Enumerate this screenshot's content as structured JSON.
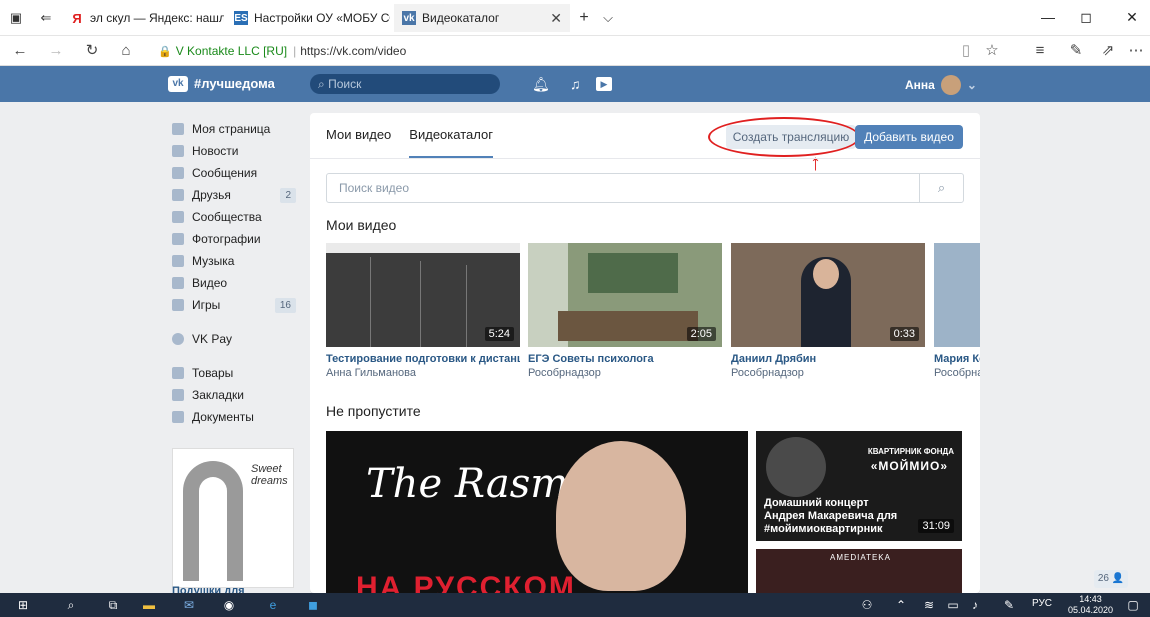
{
  "browser": {
    "tabs": [
      {
        "label": "эл скул — Яндекс: нашлось",
        "favicon": "Я",
        "color": "#e02020"
      },
      {
        "label": "Настройки ОУ «МОБУ СОШ",
        "favicon": "ES",
        "color": "#2a6fb5"
      },
      {
        "label": "Видеокаталог",
        "favicon": "vk",
        "color": "#4a76a8"
      }
    ],
    "new_tab": "+",
    "dropdown": "⌵",
    "close_tab": "✕",
    "url_site": "V Kontakte LLC [RU]",
    "url": "https://vk.com/video",
    "win_min": "—",
    "win_max": "◻",
    "win_close": "✕"
  },
  "vk": {
    "logo": "vk",
    "hashtag": "#лучшедома",
    "search_placeholder": "Поиск",
    "user_name": "Анна",
    "menu": [
      {
        "label": "Моя страница"
      },
      {
        "label": "Новости"
      },
      {
        "label": "Сообщения"
      },
      {
        "label": "Друзья",
        "count": "2"
      },
      {
        "label": "Сообщества"
      },
      {
        "label": "Фотографии"
      },
      {
        "label": "Музыка"
      },
      {
        "label": "Видео"
      },
      {
        "label": "Игры",
        "count": "16"
      },
      {
        "label": "VK Pay"
      },
      {
        "label": "Товары"
      },
      {
        "label": "Закладки"
      },
      {
        "label": "Документы"
      }
    ],
    "ad_logo": "Sweet dreams",
    "ad_title": "Подушки для"
  },
  "videos": {
    "tab_my": "Мои видео",
    "tab_catalog": "Видеокаталог",
    "btn_stream": "Создать трансляцию",
    "btn_add": "Добавить видео",
    "search_placeholder": "Поиск видео",
    "section_my": "Мои видео",
    "items": [
      {
        "title": "Тестирование подготовки к дистанц...",
        "author": "Анна Гильманова",
        "duration": "5:24"
      },
      {
        "title": "ЕГЭ Советы психолога",
        "author": "Рособрнадзор",
        "duration": "2:05"
      },
      {
        "title": "Даниил Дрябин",
        "author": "Рособрнадзор",
        "duration": "0:33"
      },
      {
        "title": "Мария Ко",
        "author": "Рособрна",
        "duration": ""
      }
    ],
    "section_missed": "Не пропустите",
    "big_band": "The Rasmus",
    "big_red": "НА РУССКОМ",
    "side1_fund": "КВАРТИРНИК ФОНДА",
    "side1_moi": "«МОЙМИО»",
    "side1_title": "Домашний концерт Андрея Макаревича для #мойимиоквартирник",
    "side1_duration": "31:09",
    "side2_brand": "AMEDIATEKA",
    "counter": "26 👤"
  },
  "taskbar": {
    "lang": "РУС",
    "time": "14:43",
    "date": "05.04.2020"
  }
}
